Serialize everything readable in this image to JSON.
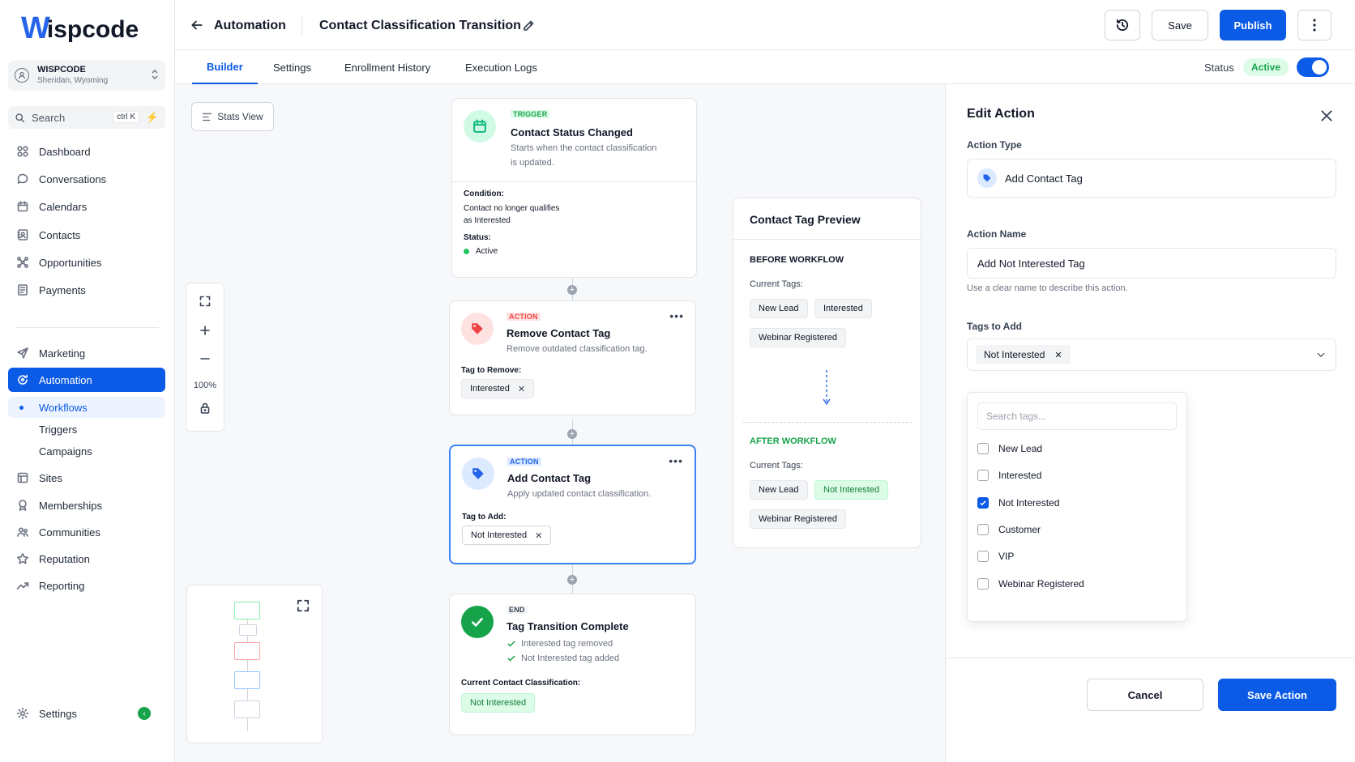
{
  "app": {
    "logo_w": "W",
    "logo_text": "ispcode"
  },
  "account": {
    "name": "WISPCODE",
    "location": "Sheridan, Wyoming"
  },
  "search": {
    "placeholder": "Search",
    "shortcut": "ctrl K"
  },
  "sidebar": {
    "items": [
      {
        "label": "Dashboard",
        "icon": "grid-icon"
      },
      {
        "label": "Conversations",
        "icon": "chat-icon"
      },
      {
        "label": "Calendars",
        "icon": "calendar-icon"
      },
      {
        "label": "Contacts",
        "icon": "contacts-icon"
      },
      {
        "label": "Opportunities",
        "icon": "opportunities-icon"
      },
      {
        "label": "Payments",
        "icon": "payments-icon"
      },
      {
        "label": "Marketing",
        "icon": "send-icon"
      },
      {
        "label": "Automation",
        "icon": "automation-icon",
        "active": true
      }
    ],
    "sub_items": [
      {
        "label": "Workflows",
        "active": true
      },
      {
        "label": "Triggers"
      },
      {
        "label": "Campaigns"
      }
    ],
    "items2": [
      {
        "label": "Sites",
        "icon": "sites-icon"
      },
      {
        "label": "Memberships",
        "icon": "membership-icon"
      },
      {
        "label": "Communities",
        "icon": "communities-icon"
      },
      {
        "label": "Reputation",
        "icon": "star-icon"
      },
      {
        "label": "Reporting",
        "icon": "trend-icon"
      }
    ],
    "settings": "Settings"
  },
  "header": {
    "breadcrumb": "Automation",
    "workflow_name": "Contact Classification Transition",
    "save": "Save",
    "publish": "Publish"
  },
  "tabs": [
    "Builder",
    "Settings",
    "Enrollment History",
    "Execution Logs"
  ],
  "status": {
    "label": "Status",
    "value": "Active",
    "enabled": true
  },
  "canvas": {
    "stats_view": "Stats View",
    "zoom": "100%",
    "trigger": {
      "tag": "TRIGGER",
      "title": "Contact Status Changed",
      "desc_1": "Starts when the contact classification",
      "desc_2": "is updated.",
      "condition_label": "Condition:",
      "condition_1": "Contact no longer qualifies",
      "condition_2": "as Interested",
      "status_label": "Status:",
      "status_value": "Active"
    },
    "action1": {
      "tag": "ACTION",
      "title": "Remove Contact Tag",
      "desc": "Remove outdated classification tag.",
      "field_label": "Tag to Remove:",
      "chip": "Interested"
    },
    "action2": {
      "tag": "ACTION",
      "title": "Add Contact Tag",
      "desc": "Apply updated contact classification.",
      "field_label": "Tag to Add:",
      "chip": "Not Interested"
    },
    "end": {
      "tag": "END",
      "title": "Tag Transition Complete",
      "check_1": "Interested tag removed",
      "check_2": "Not Interested tag added",
      "class_label": "Current Contact Classification:",
      "class_value": "Not Interested"
    }
  },
  "preview": {
    "title": "Contact Tag Preview",
    "before": "BEFORE WORKFLOW",
    "before_sub": "Current Tags:",
    "before_tags": [
      "New Lead",
      "Interested",
      "Webinar Registered"
    ],
    "after": "AFTER WORKFLOW",
    "after_sub": "Current Tags:",
    "after_tags": [
      "New Lead",
      "Not Interested",
      "Webinar Registered"
    ]
  },
  "panel": {
    "title": "Edit Action",
    "type_label": "Action Type",
    "type_value": "Add Contact Tag",
    "name_label": "Action Name",
    "name_value": "Add Not Interested Tag",
    "name_hint": "Use a clear name to describe this action.",
    "tags_label": "Tags to Add",
    "selected_tag": "Not Interested",
    "search_placeholder": "Search tags...",
    "options": [
      {
        "label": "New Lead",
        "checked": false
      },
      {
        "label": "Interested",
        "checked": false
      },
      {
        "label": "Not Interested",
        "checked": true
      },
      {
        "label": "Customer",
        "checked": false
      },
      {
        "label": "VIP",
        "checked": false
      },
      {
        "label": "Webinar Registered",
        "checked": false
      }
    ],
    "cancel": "Cancel",
    "save": "Save Action"
  },
  "colors": {
    "primary": "#0b5be6",
    "success": "#16a34a",
    "danger": "#ef4444"
  }
}
